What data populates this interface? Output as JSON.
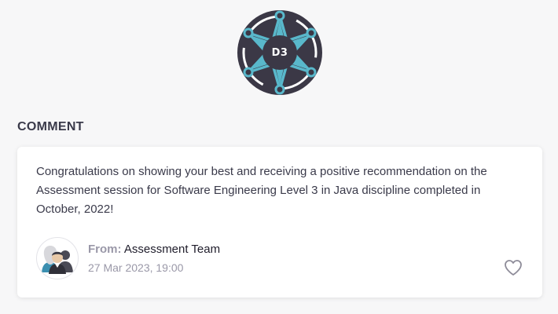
{
  "badge": {
    "code": "D3",
    "colors": {
      "background": "#3b3846",
      "star": "#59b8cb",
      "ring": "#ffffff"
    },
    "icon": "sheriff-star-badge-icon"
  },
  "comment_section": {
    "heading": "COMMENT",
    "text": "Congratulations on showing your best and receiving a positive recommendation on the Assessment session for Software Engineering Level 3 in Java discipline completed in October, 2022!",
    "author": {
      "from_label": "From:",
      "name": "Assessment Team",
      "avatar_icon": "team-avatar-icon"
    },
    "timestamp": "27 Mar 2023, 19:00",
    "like_icon": "heart-outline-icon"
  }
}
